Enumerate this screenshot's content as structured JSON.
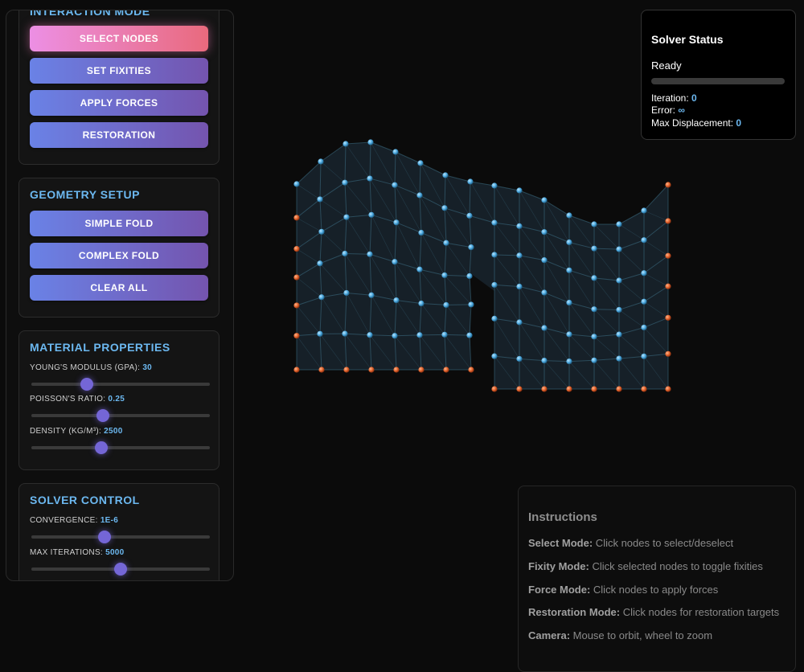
{
  "interaction_mode": {
    "title": "INTERACTION MODE",
    "buttons": [
      {
        "label": "SELECT NODES",
        "active": true
      },
      {
        "label": "SET FIXITIES",
        "active": false
      },
      {
        "label": "APPLY FORCES",
        "active": false
      },
      {
        "label": "RESTORATION",
        "active": false
      }
    ]
  },
  "geometry_setup": {
    "title": "GEOMETRY SETUP",
    "buttons": [
      {
        "label": "SIMPLE FOLD"
      },
      {
        "label": "COMPLEX FOLD"
      },
      {
        "label": "CLEAR ALL"
      }
    ]
  },
  "material_properties": {
    "title": "MATERIAL PROPERTIES",
    "sliders": [
      {
        "label": "YOUNG'S MODULUS (GPA): ",
        "value": "30",
        "fraction": 0.31
      },
      {
        "label": "POISSON'S RATIO: ",
        "value": "0.25",
        "fraction": 0.4
      },
      {
        "label": "DENSITY (KG/M³): ",
        "value": "2500",
        "fraction": 0.39
      }
    ]
  },
  "solver_control": {
    "title": "SOLVER CONTROL",
    "sliders": [
      {
        "label": "CONVERGENCE: ",
        "value": "1E-6",
        "fraction": 0.41
      },
      {
        "label": "MAX ITERATIONS: ",
        "value": "5000",
        "fraction": 0.5
      }
    ]
  },
  "solver_status": {
    "title": "Solver Status",
    "state": "Ready",
    "progress": 0,
    "iteration_label": "Iteration: ",
    "iteration_value": "0",
    "error_label": "Error: ",
    "error_value": "∞",
    "max_disp_label": "Max Displacement: ",
    "max_disp_value": "0"
  },
  "instructions": {
    "title": "Instructions",
    "items": [
      {
        "key": "Select Mode:",
        "text": " Click nodes to select/deselect"
      },
      {
        "key": "Fixity Mode:",
        "text": " Click selected nodes to toggle fixities"
      },
      {
        "key": "Force Mode:",
        "text": " Click nodes to apply forces"
      },
      {
        "key": "Restoration Mode:",
        "text": " Click nodes for restoration targets"
      },
      {
        "key": "Camera:",
        "text": " Mouse to orbit, wheel to zoom"
      }
    ]
  },
  "colors": {
    "free_node": "#5ab4e4",
    "fixed_node": "#e0602a",
    "mesh_line": "#3d6f85",
    "mesh_fill": "#17222a"
  }
}
